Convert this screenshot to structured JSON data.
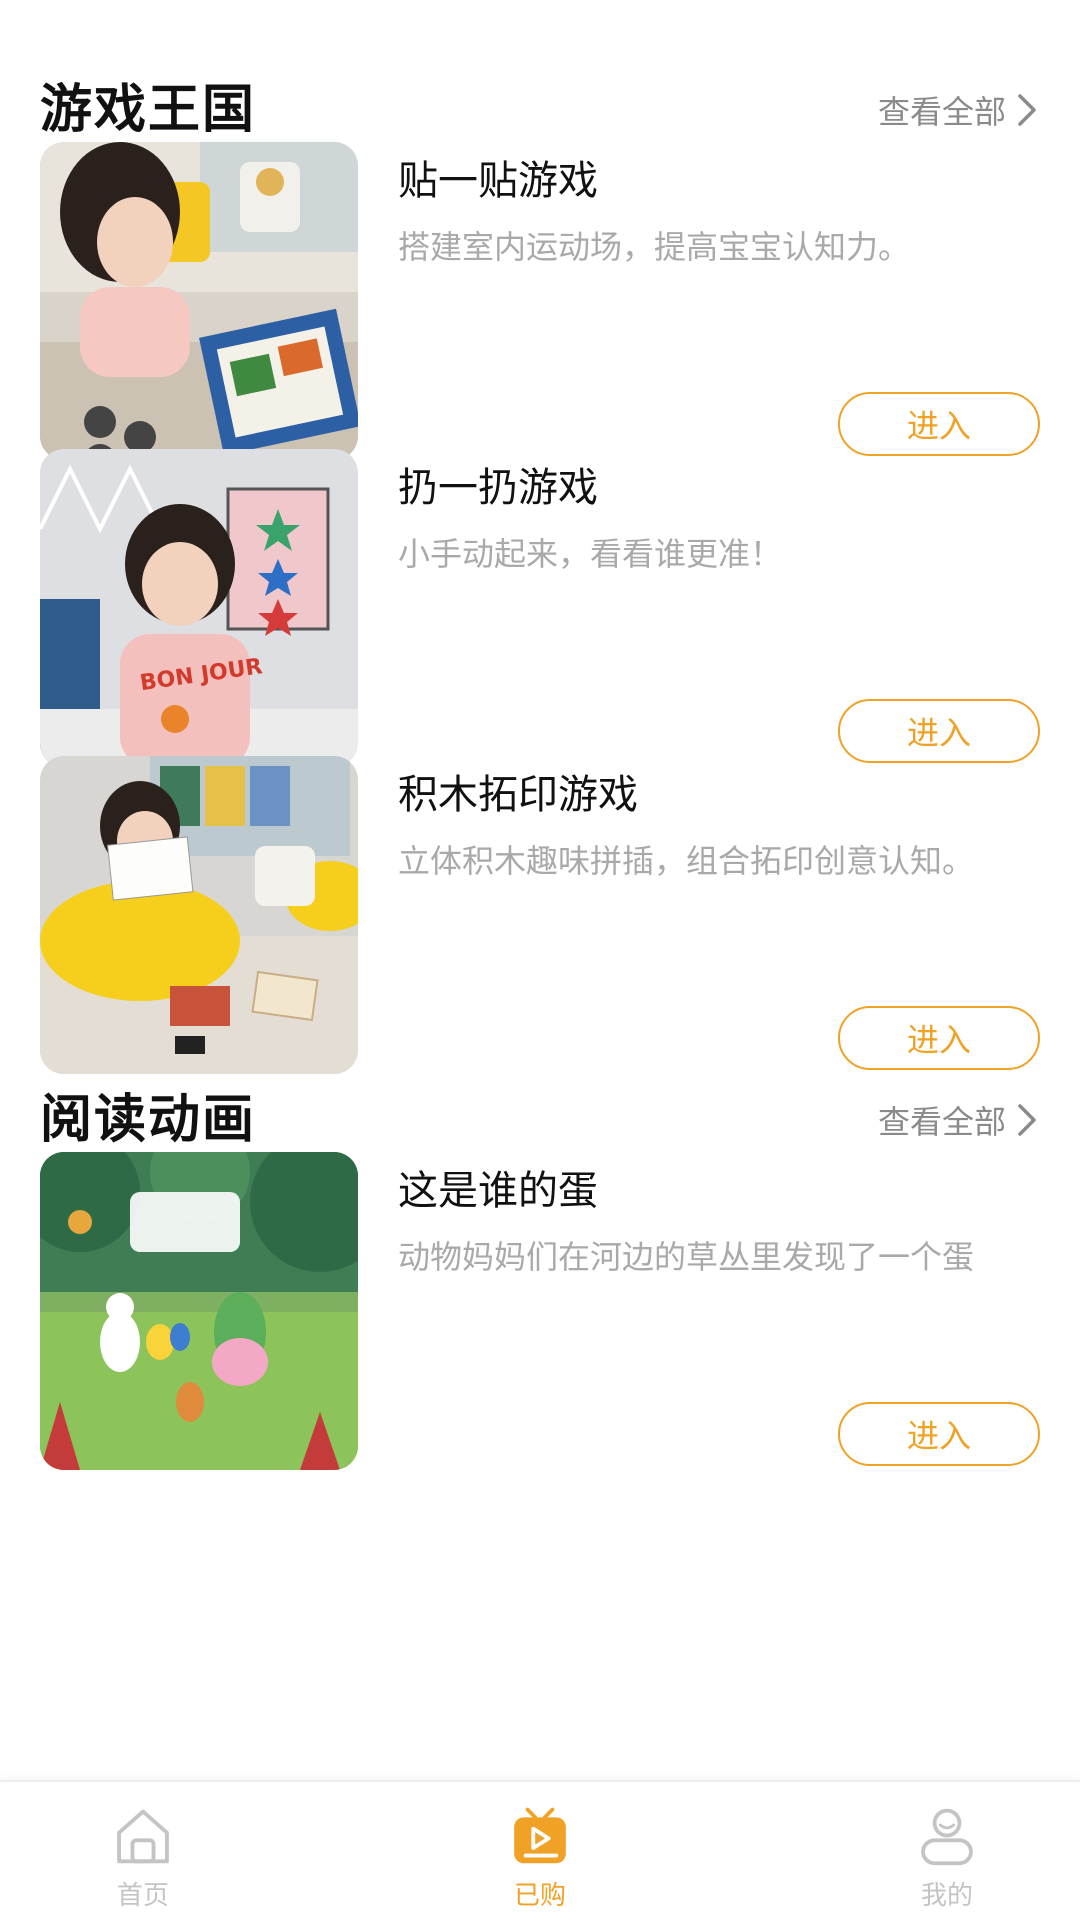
{
  "sections": [
    {
      "title": "游戏王国",
      "view_all": "查看全部",
      "items": [
        {
          "title": "贴一贴游戏",
          "desc": "搭建室内运动场，提高宝宝认知力。",
          "button": "进入"
        },
        {
          "title": "扔一扔游戏",
          "desc": "小手动起来，看看谁更准！",
          "button": "进入"
        },
        {
          "title": "积木拓印游戏",
          "desc": "立体积木趣味拼插，组合拓印创意认知。",
          "button": "进入"
        }
      ]
    },
    {
      "title": "阅读动画",
      "view_all": "查看全部",
      "items": [
        {
          "title": "这是谁的蛋",
          "desc": "动物妈妈们在河边的草丛里发现了一个蛋",
          "button": "进入"
        }
      ]
    }
  ],
  "tabbar": {
    "items": [
      {
        "label": "首页",
        "icon": "home-icon",
        "active": false
      },
      {
        "label": "已购",
        "icon": "purchased-play-icon",
        "active": true
      },
      {
        "label": "我的",
        "icon": "profile-icon",
        "active": false
      }
    ],
    "active_color": "#f0a226",
    "inactive_color": "#c4c4c4"
  },
  "colors": {
    "accent": "#f0a226",
    "desc_text": "#a9a9a9",
    "view_all_text": "#8a8a8a"
  }
}
